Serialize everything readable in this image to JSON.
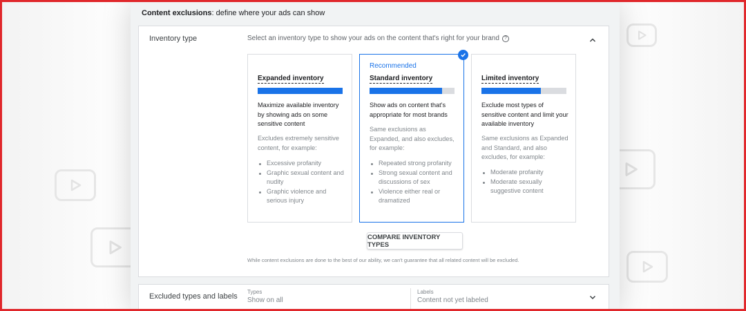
{
  "header": {
    "title_bold": "Content exclusions",
    "title_rest": ": define where your ads can show"
  },
  "inventory_section": {
    "label": "Inventory type",
    "description": "Select an inventory type to show your ads on the content that's right for your brand",
    "help_icon": "?",
    "cards": [
      {
        "recommended": "",
        "title": "Expanded inventory",
        "level": 1.0,
        "main": "Maximize available inventory by showing ads on some sensitive content",
        "sub": "Excludes extremely sensitive content, for example:",
        "list": [
          "Excessive profanity",
          "Graphic sexual content and nudity",
          "Graphic violence and serious injury"
        ],
        "selected": false
      },
      {
        "recommended": "Recommended",
        "title": "Standard inventory",
        "level": 0.85,
        "main": "Show ads on content that's appropriate for most brands",
        "sub": "Same exclusions as Expanded, and also excludes, for example:",
        "list": [
          "Repeated strong profanity",
          "Strong sexual content and discussions of sex",
          "Violence either real or dramatized"
        ],
        "selected": true
      },
      {
        "recommended": "",
        "title": "Limited inventory",
        "level": 0.7,
        "main": "Exclude most types of sensitive content and limit your available inventory",
        "sub": "Same exclusions as Expanded and Standard, and also excludes, for example:",
        "list": [
          "Moderate profanity",
          "Moderate sexually suggestive content"
        ],
        "selected": false
      }
    ],
    "compare_button": "COMPARE INVENTORY TYPES",
    "disclaimer": "While content exclusions are done to the best of our ability, we can't guarantee that all related content will be excluded."
  },
  "excluded_section": {
    "label": "Excluded types and labels",
    "types_label": "Types",
    "types_value": "Show on all",
    "labels_label": "Labels",
    "labels_value": "Content not yet labeled"
  },
  "colors": {
    "accent": "#1a73e8",
    "frame_border": "#e0272b"
  },
  "icons": {
    "collapse": "chevron-up-icon",
    "expand": "chevron-down-icon",
    "selected": "check-circle-icon",
    "background": "play-button-icon"
  }
}
